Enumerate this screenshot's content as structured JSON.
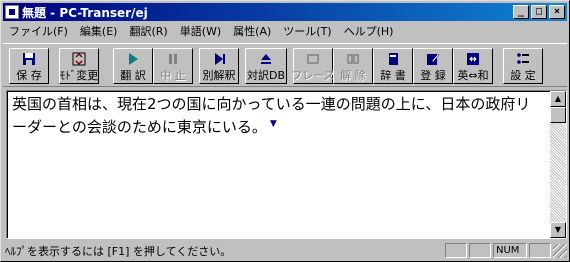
{
  "window": {
    "title": "無題 - PC-Transer/ej",
    "minimize_glyph": "_",
    "maximize_glyph": "□",
    "close_glyph": "×"
  },
  "menu": [
    {
      "label": "ファイル(F)"
    },
    {
      "label": "編集(E)"
    },
    {
      "label": "翻訳(R)"
    },
    {
      "label": "単語(W)"
    },
    {
      "label": "属性(A)"
    },
    {
      "label": "ツール(T)"
    },
    {
      "label": "ヘルプ(H)"
    }
  ],
  "toolbar": {
    "save": "保 存",
    "mode": "ﾓﾄﾞ変更",
    "translate": "翻 訳",
    "stop": "中 止",
    "alt_trans": "別解釈",
    "db": "対訳DB",
    "phrase": "フレーズ",
    "release": "解 除",
    "dict": "辞 書",
    "register": "登 録",
    "direction": "英⇔和",
    "settings": "設 定"
  },
  "document": {
    "text": "英国の首相は、現在2つの国に向かっている一連の問題の上に、日本の政府リーダーとの会談のために東京にいる。"
  },
  "statusbar": {
    "help_text": "ﾍﾙﾌﾟを表示するには [F1] を押してください。",
    "num": "NUM"
  },
  "colors": {
    "title_start": "#000080",
    "title_end": "#1084d0",
    "face": "#c0c0c0",
    "accent": "#008080"
  }
}
